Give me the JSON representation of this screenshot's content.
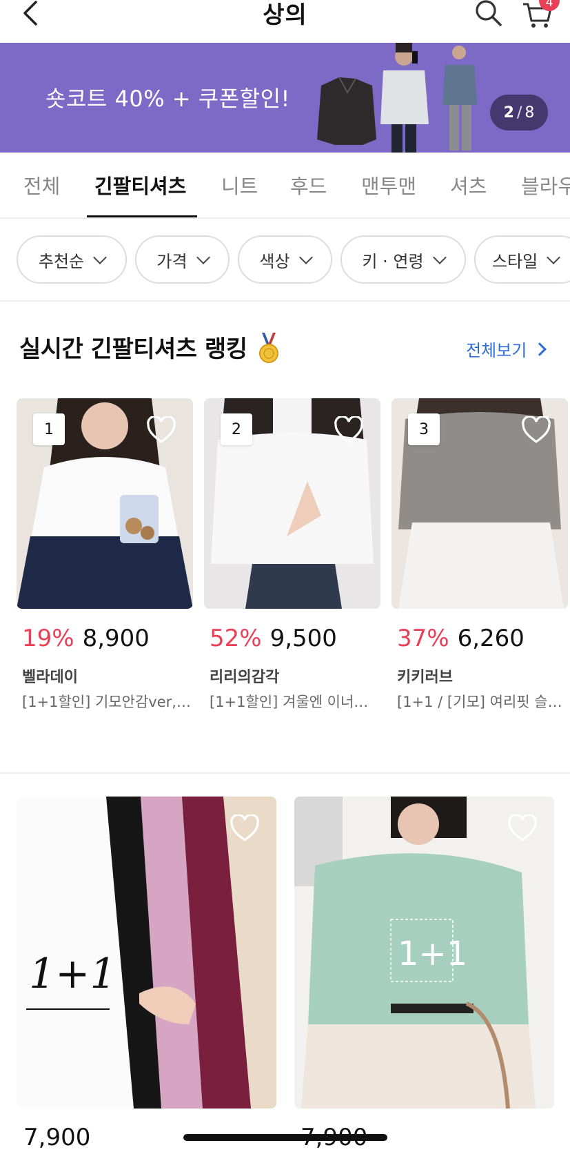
{
  "header": {
    "title": "상의",
    "cart_count": "4",
    "icons": {
      "back": "chevron-left-icon",
      "search": "search-icon",
      "cart": "cart-icon"
    }
  },
  "banner": {
    "text": "숏코트 40% + 쿠폰할인!",
    "page_current": "2",
    "page_sep": "/",
    "page_total": "8",
    "background": "#7d6ac6"
  },
  "tabs": [
    {
      "label": "전체",
      "active": false
    },
    {
      "label": "긴팔티셔츠",
      "active": true
    },
    {
      "label": "니트",
      "active": false
    },
    {
      "label": "후드",
      "active": false
    },
    {
      "label": "맨투맨",
      "active": false
    },
    {
      "label": "셔츠",
      "active": false
    },
    {
      "label": "블라우",
      "active": false
    }
  ],
  "filters": [
    {
      "label": "추천순"
    },
    {
      "label": "가격"
    },
    {
      "label": "색상"
    },
    {
      "label": "키 · 연령"
    },
    {
      "label": "스타일"
    }
  ],
  "ranking": {
    "title": "실시간 긴팔티셔츠 랭킹",
    "see_all": "전체보기",
    "items": [
      {
        "rank": "1",
        "discount": "19%",
        "price": "8,900",
        "brand": "벨라데이",
        "name": "[1+1할인] 기모안감ver,…"
      },
      {
        "rank": "2",
        "discount": "52%",
        "price": "9,500",
        "brand": "리리의감각",
        "name": "[1+1할인] 겨울엔 이너…"
      },
      {
        "rank": "3",
        "discount": "37%",
        "price": "6,260",
        "brand": "키키러브",
        "name": "[1+1 / [기모] 여리핏 슬…"
      }
    ]
  },
  "grid": {
    "items": [
      {
        "overlay": "1+1",
        "price": "7,900"
      },
      {
        "overlay": "1+1",
        "price": "7,900"
      }
    ]
  },
  "colors": {
    "accent_red": "#e94057",
    "link_blue": "#2f6bd6"
  }
}
